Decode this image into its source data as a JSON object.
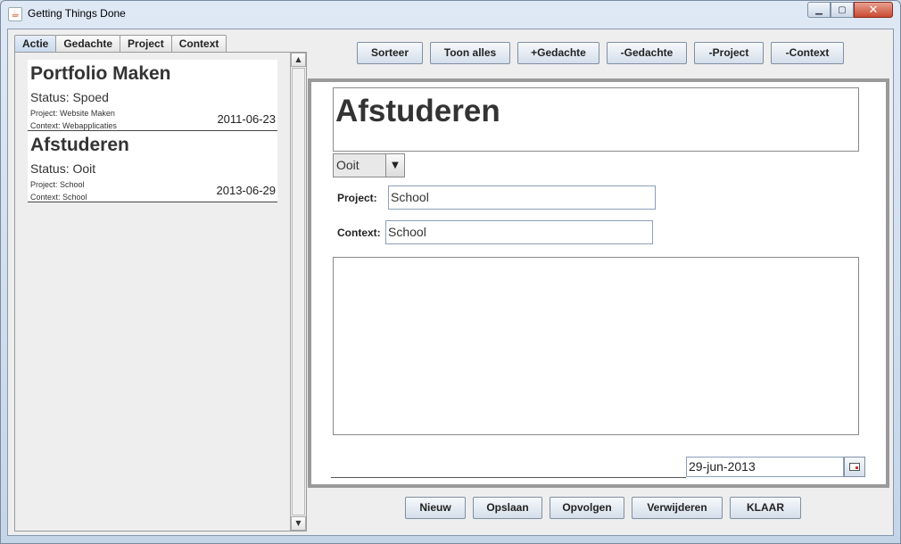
{
  "window": {
    "title": "Getting Things Done"
  },
  "tabs": [
    {
      "label": "Actie",
      "active": true
    },
    {
      "label": "Gedachte",
      "active": false
    },
    {
      "label": "Project",
      "active": false
    },
    {
      "label": "Context",
      "active": false
    }
  ],
  "actions_list": [
    {
      "title": "Portfolio Maken",
      "status": "Status: Spoed",
      "project": "Project: Website Maken",
      "context": "Context: Webapplicaties",
      "date": "2011-06-23"
    },
    {
      "title": "Afstuderen",
      "status": "Status: Ooit",
      "project": "Project: School",
      "context": "Context: School",
      "date": "2013-06-29"
    }
  ],
  "toolbar": {
    "sort": "Sorteer",
    "show_all": "Toon alles",
    "add_thought": "+Gedachte",
    "remove_thought": "-Gedachte",
    "remove_project": "-Project",
    "remove_context": "-Context"
  },
  "editor": {
    "name": "Afstuderen",
    "status": "Ooit",
    "project_label": "Project:",
    "project_value": "School",
    "context_label": "Context:",
    "context_value": "School",
    "notes": "",
    "date": "29-jun-2013"
  },
  "bottom_buttons": {
    "new": "Nieuw",
    "save": "Opslaan",
    "follow_up": "Opvolgen",
    "delete": "Verwijderen",
    "done": "KLAAR"
  },
  "icons": {
    "app": "java-cup-icon",
    "minimize": "minimize-icon",
    "maximize": "maximize-icon",
    "close": "close-icon",
    "calendar": "calendar-icon"
  }
}
